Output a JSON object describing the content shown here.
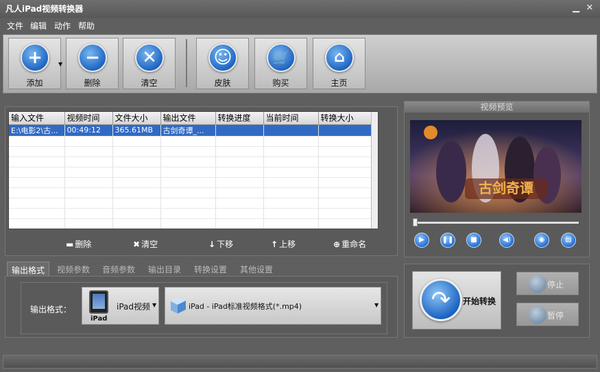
{
  "window": {
    "title": "凡人iPad视频转换器"
  },
  "menu": [
    "文件",
    "编辑",
    "动作",
    "帮助"
  ],
  "toolbar": {
    "add": "添加",
    "delete": "删除",
    "clear": "清空",
    "skin": "皮肤",
    "buy": "购买",
    "home": "主页"
  },
  "table": {
    "headers": [
      "输入文件",
      "视频时间",
      "文件大小",
      "输出文件",
      "转换进度",
      "当前时间",
      "转换大小"
    ],
    "rows": [
      [
        "E:\\电影2\\古...",
        "00:49:12",
        "365.61MB",
        "古剑奇谭_...",
        "",
        "",
        ""
      ]
    ]
  },
  "list_actions": {
    "delete": "删除",
    "clear": "清空",
    "down": "下移",
    "up": "上移",
    "rename": "重命名"
  },
  "preview": {
    "title": "视频预览",
    "video_caption": "古剑奇谭"
  },
  "tabs": [
    "输出格式",
    "视频参数",
    "音频参数",
    "输出目录",
    "转换设置",
    "其他设置"
  ],
  "output": {
    "label": "输出格式：",
    "device": "iPad视频",
    "device_icon_text": "iPad",
    "format": "iPad - iPad标准视频格式(*.mp4)"
  },
  "actions": {
    "start": "开始转换",
    "stop": "停止",
    "pause": "暂停"
  }
}
